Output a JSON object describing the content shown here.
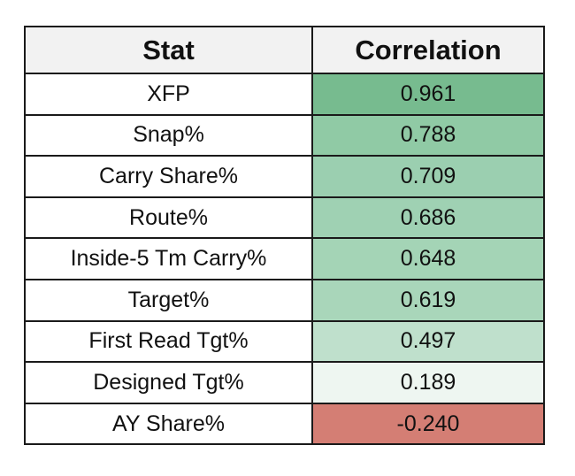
{
  "table": {
    "headers": [
      "Stat",
      "Correlation"
    ],
    "rows": [
      {
        "stat": "XFP",
        "correlation": "0.961",
        "color": "#77bb8f"
      },
      {
        "stat": "Snap%",
        "correlation": "0.788",
        "color": "#90caa5"
      },
      {
        "stat": "Carry Share%",
        "correlation": "0.709",
        "color": "#9bcfb0"
      },
      {
        "stat": "Route%",
        "correlation": "0.686",
        "color": "#9fd1b3"
      },
      {
        "stat": "Inside-5 Tm Carry%",
        "correlation": "0.648",
        "color": "#a4d4b6"
      },
      {
        "stat": "Target%",
        "correlation": "0.619",
        "color": "#a9d6ba"
      },
      {
        "stat": "First Read Tgt%",
        "correlation": "0.497",
        "color": "#bfe0cc"
      },
      {
        "stat": "Designed Tgt%",
        "correlation": "0.189",
        "color": "#eef6f1"
      },
      {
        "stat": "AY Share%",
        "correlation": "-0.240",
        "color": "#d47e74"
      }
    ]
  }
}
